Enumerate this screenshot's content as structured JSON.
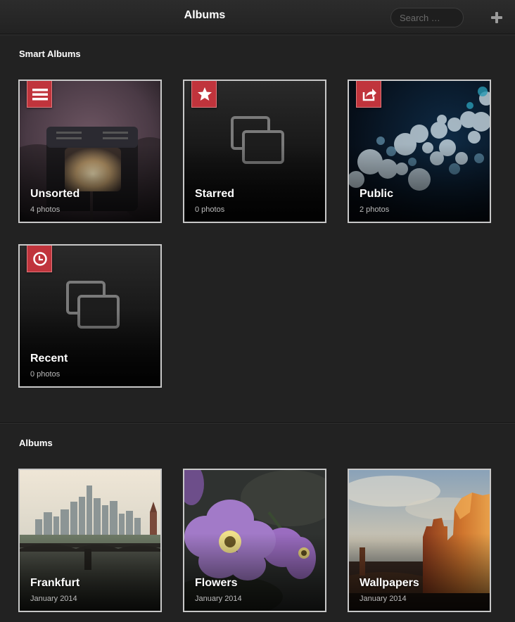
{
  "header": {
    "title": "Albums",
    "search_placeholder": "Search …",
    "add_icon": "plus-icon"
  },
  "smart_albums": {
    "title": "Smart Albums",
    "items": [
      {
        "name": "Unsorted",
        "sub": "4 photos",
        "icon": "list-icon"
      },
      {
        "name": "Starred",
        "sub": "0 photos",
        "icon": "star-icon"
      },
      {
        "name": "Public",
        "sub": "2 photos",
        "icon": "share-icon"
      },
      {
        "name": "Recent",
        "sub": "0 photos",
        "icon": "clock-icon"
      }
    ]
  },
  "albums": {
    "title": "Albums",
    "items": [
      {
        "name": "Frankfurt",
        "sub": "January 2014"
      },
      {
        "name": "Flowers",
        "sub": "January 2014"
      },
      {
        "name": "Wallpapers",
        "sub": "January 2014"
      }
    ]
  },
  "colors": {
    "background": "#222222",
    "badge": "#c0343c",
    "border": "#c8c8c8"
  }
}
